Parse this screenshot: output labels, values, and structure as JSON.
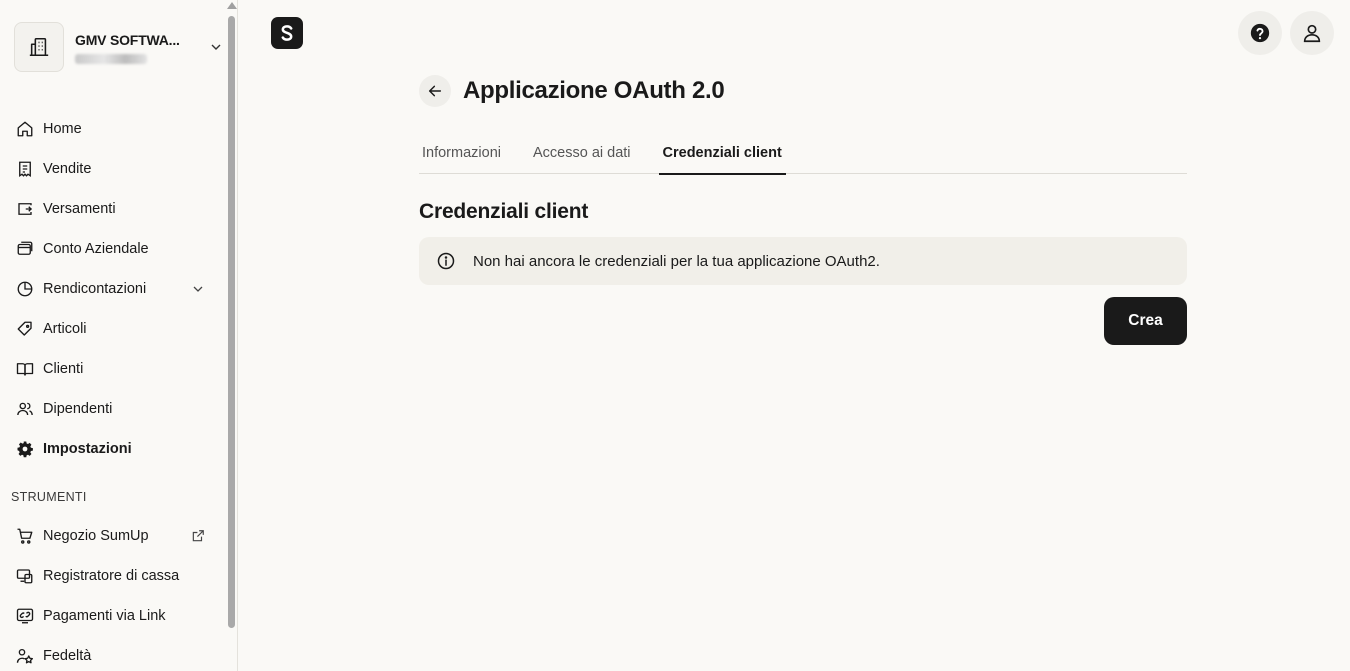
{
  "merchant": {
    "name": "GMV SOFTWA..."
  },
  "sidebar": {
    "items": [
      {
        "label": "Home",
        "icon": "home-icon"
      },
      {
        "label": "Vendite",
        "icon": "receipt-icon"
      },
      {
        "label": "Versamenti",
        "icon": "wallet-icon"
      },
      {
        "label": "Conto Aziendale",
        "icon": "card-icon"
      },
      {
        "label": "Rendicontazioni",
        "icon": "pie-chart-icon"
      },
      {
        "label": "Articoli",
        "icon": "tag-icon"
      },
      {
        "label": "Clienti",
        "icon": "book-icon"
      },
      {
        "label": "Dipendenti",
        "icon": "users-icon"
      },
      {
        "label": "Impostazioni",
        "icon": "gear-icon",
        "active": true
      }
    ],
    "section_label": "STRUMENTI",
    "tools": [
      {
        "label": "Negozio SumUp",
        "icon": "cart-icon"
      },
      {
        "label": "Registratore di cassa",
        "icon": "pos-icon"
      },
      {
        "label": "Pagamenti via Link",
        "icon": "link-payment-icon"
      },
      {
        "label": "Fedeltà",
        "icon": "loyalty-icon"
      }
    ]
  },
  "page": {
    "title": "Applicazione OAuth 2.0",
    "tabs": [
      {
        "label": "Informazioni"
      },
      {
        "label": "Accesso ai dati"
      },
      {
        "label": "Credenziali client",
        "active": true
      }
    ],
    "section_title": "Credenziali client",
    "notice": "Non hai ancora le credenziali per la tua applicazione OAuth2.",
    "create_label": "Crea"
  },
  "colors": {
    "primary": "#1a1a1a",
    "background": "#faf9f6",
    "notice_bg": "#f1efe9"
  }
}
